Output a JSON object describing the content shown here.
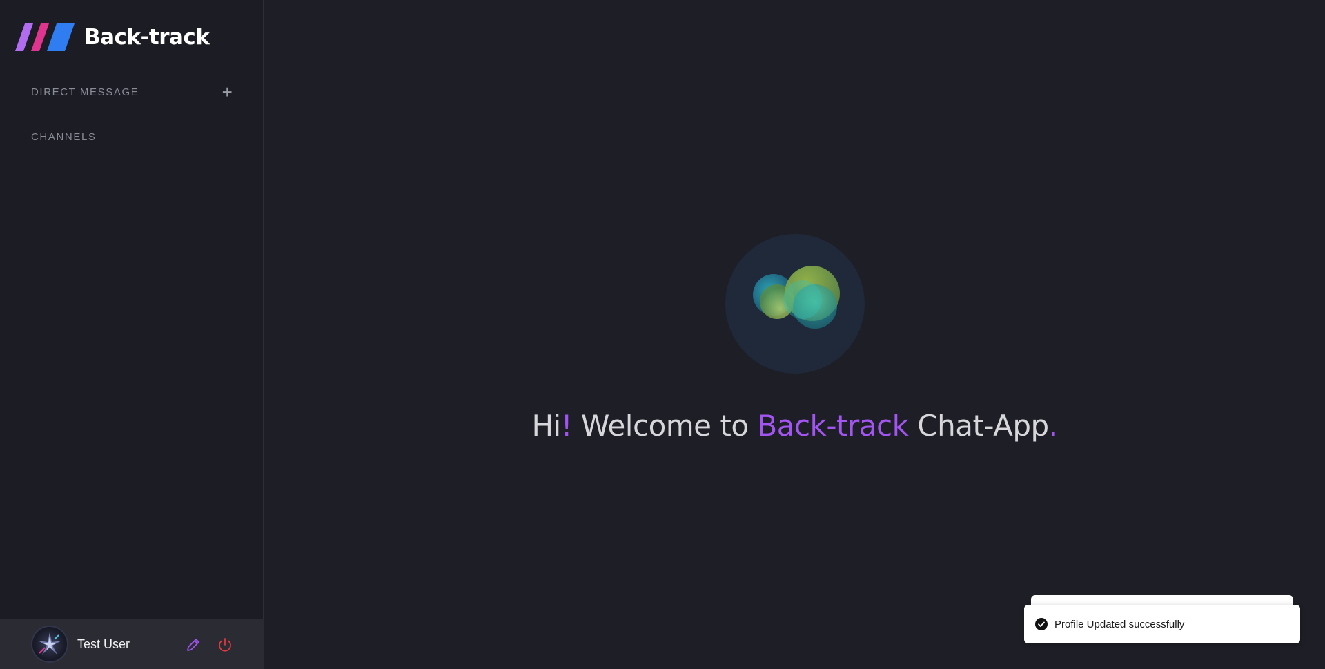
{
  "app": {
    "name": "Back-track"
  },
  "sidebar": {
    "direct_message_label": "DIRECT MESSAGE",
    "add_icon": "plus-icon",
    "channels_label": "CHANNELS"
  },
  "profile": {
    "username": "Test User",
    "edit_icon": "pencil-icon",
    "logout_icon": "power-icon"
  },
  "welcome": {
    "hi": "Hi",
    "exclaim": "!",
    "welcome_to": " Welcome to ",
    "brand": "Back-track",
    "chat_app": " Chat-App",
    "period": "."
  },
  "toast": {
    "message": "Profile Updated successfully",
    "icon": "check-circle-icon"
  },
  "colors": {
    "accent_purple": "#a255f0",
    "logout_red": "#e0393e",
    "background": "#1e1e26"
  }
}
